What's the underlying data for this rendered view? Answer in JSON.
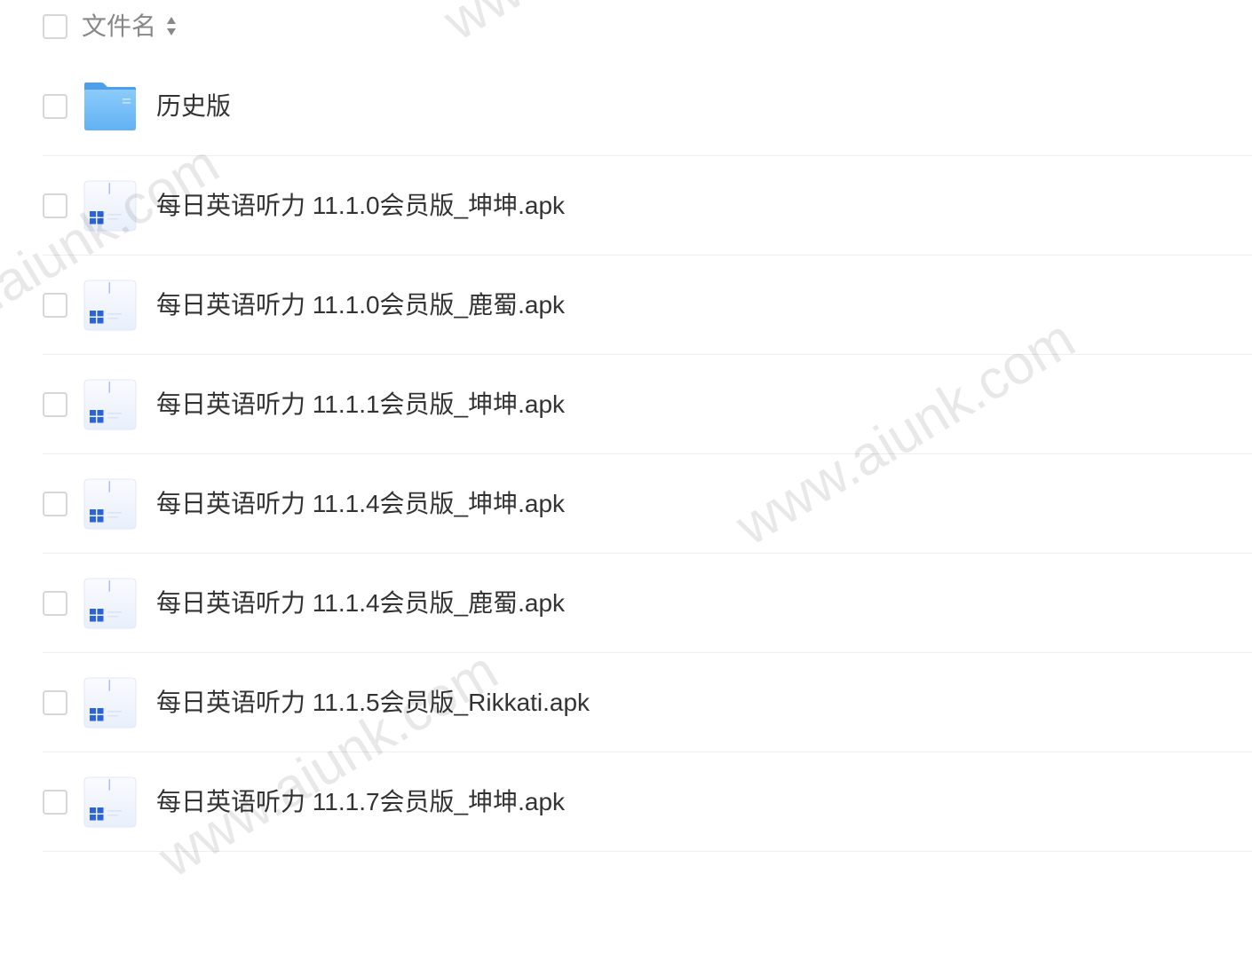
{
  "header": {
    "select_all_checked": false,
    "name_column_label": "文件名",
    "sort_icon": "sort-icon"
  },
  "files": [
    {
      "name": "历史版",
      "icon": "folder-icon",
      "checked": false
    },
    {
      "name": "每日英语听力 11.1.0会员版_坤坤.apk",
      "icon": "apk-file-icon",
      "checked": false
    },
    {
      "name": "每日英语听力 11.1.0会员版_鹿蜀.apk",
      "icon": "apk-file-icon",
      "checked": false
    },
    {
      "name": "每日英语听力 11.1.1会员版_坤坤.apk",
      "icon": "apk-file-icon",
      "checked": false
    },
    {
      "name": "每日英语听力 11.1.4会员版_坤坤.apk",
      "icon": "apk-file-icon",
      "checked": false
    },
    {
      "name": "每日英语听力 11.1.4会员版_鹿蜀.apk",
      "icon": "apk-file-icon",
      "checked": false
    },
    {
      "name": "每日英语听力 11.1.5会员版_Rikkati.apk",
      "icon": "apk-file-icon",
      "checked": false
    },
    {
      "name": "每日英语听力 11.1.7会员版_坤坤.apk",
      "icon": "apk-file-icon",
      "checked": false
    }
  ],
  "watermark": "www.aiunk.com",
  "colors": {
    "text": "#333333",
    "header_text": "#888888",
    "divider": "#eeeeee",
    "checkbox_border": "#d6d6d6",
    "folder_blue": "#62b1f4",
    "file_icon_accent": "#2a64d8"
  }
}
